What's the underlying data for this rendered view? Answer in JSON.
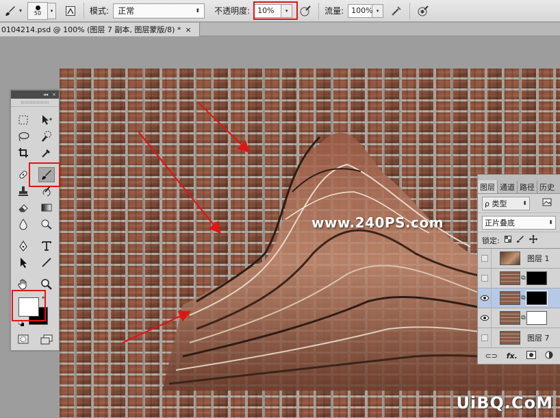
{
  "options_bar": {
    "brush_size": "50",
    "mode_label": "模式:",
    "mode_value": "正常",
    "opacity_label": "不透明度:",
    "opacity_value": "10%",
    "flow_label": "流量:",
    "flow_value": "100%"
  },
  "document_tab": {
    "title": "0104214.psd @ 100% (图层 7 副本, 图层蒙版/8) *",
    "close": "×"
  },
  "canvas": {
    "watermark": "www.240PS.com"
  },
  "tools_panel": {
    "collapse": "◂◂",
    "close": "×",
    "foreground_color": "#ffffff",
    "background_color": "#000000"
  },
  "layers_panel": {
    "tabs": [
      {
        "label": "图层"
      },
      {
        "label": "通道"
      },
      {
        "label": "路径"
      },
      {
        "label": "历史"
      }
    ],
    "filter_value": "ρ 类型",
    "blend_mode": "正片叠底",
    "lock_label": "锁定:",
    "layers": [
      {
        "name": "图层 1",
        "visible": false,
        "selected": false
      },
      {
        "name": "",
        "visible": false,
        "selected": false
      },
      {
        "name": "",
        "visible": true,
        "selected": true
      },
      {
        "name": "",
        "visible": true,
        "selected": false
      },
      {
        "name": "图层 7",
        "visible": false,
        "selected": false
      }
    ],
    "footer_fx": "fx."
  },
  "site_watermark": "UiBQ.CoM",
  "colors": {
    "highlight_red": "#e01515",
    "selected_layer": "#b6c9e6"
  }
}
